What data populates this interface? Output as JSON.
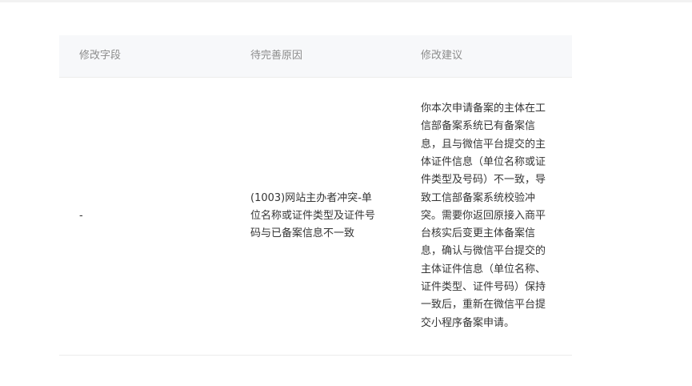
{
  "table": {
    "headers": {
      "field": "修改字段",
      "reason": "待完善原因",
      "suggestion": "修改建议"
    },
    "rows": [
      {
        "field": "-",
        "reason": "(1003)网站主办者冲突-单位名称或证件类型及证件号码与已备案信息不一致",
        "suggestion": "你本次申请备案的主体在工信部备案系统已有备案信息，且与微信平台提交的主体证件信息（单位名称或证件类型及号码）不一致，导致工信部备案系统校验冲突。需要你返回原接入商平台核实后变更主体备案信息，确认与微信平台提交的主体证件信息（单位名称、证件类型、证件号码）保持一致后，重新在微信平台提交小程序备案申请。"
      }
    ]
  }
}
